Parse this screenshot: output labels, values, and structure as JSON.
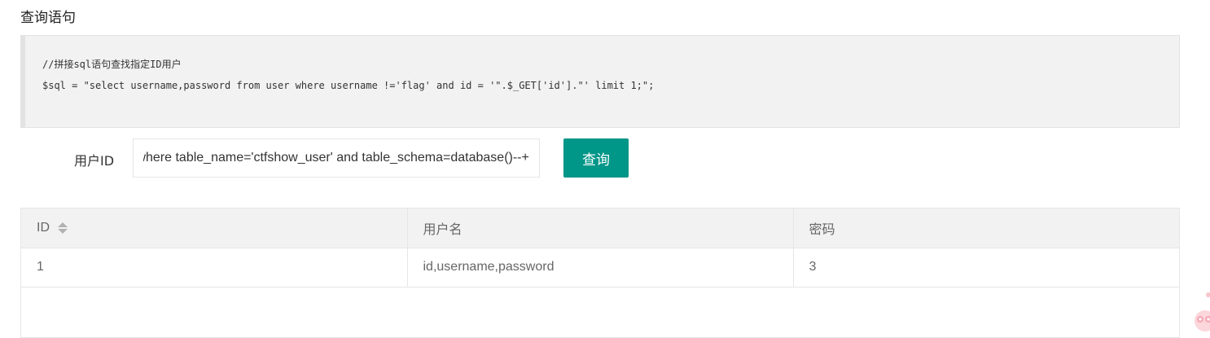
{
  "section": {
    "title": "查询语句"
  },
  "code": {
    "comment": "//拼接sql语句查找指定ID用户",
    "statement": "$sql = \"select username,password from user where username !='flag' and id = '\".$_GET['id'].\"' limit 1;\";"
  },
  "form": {
    "id_label": "用户ID",
    "id_value": "s where table_name='ctfshow_user' and table_schema=database()--+",
    "query_button": "查询"
  },
  "table": {
    "headers": [
      "ID",
      "用户名",
      "密码"
    ],
    "rows": [
      [
        "1",
        "id,username,password",
        "3"
      ]
    ]
  },
  "colors": {
    "accent": "#009688",
    "code_bg": "#f2f2f2",
    "header_bg": "#f2f2f2",
    "border": "#e6e6e6"
  },
  "icons": {
    "sort": "sort-icon",
    "mascot": "pink-mascot-icon"
  }
}
